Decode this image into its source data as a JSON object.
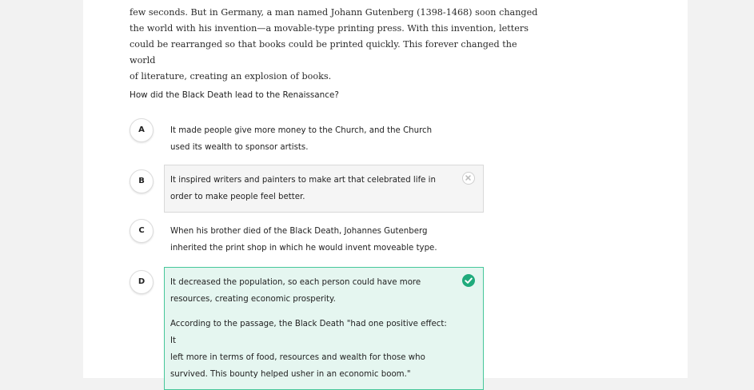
{
  "passage": {
    "lines": [
      "few seconds. But in Germany, a man named Johann Gutenberg (1398-1468) soon changed",
      "the world with his invention—a movable-type printing press. With this invention, letters",
      "could be rearranged so that books could be printed quickly. This forever changed the world",
      "of literature, creating an explosion of books."
    ]
  },
  "question": "How did the Black Death lead to the Renaissance?",
  "options": [
    {
      "letter": "A",
      "lines": [
        "It made people give more money to the Church, and the Church",
        "used its wealth to sponsor artists."
      ],
      "state": "unselected"
    },
    {
      "letter": "B",
      "lines": [
        "It inspired writers and painters to make art that celebrated life in",
        "order to make people feel better."
      ],
      "state": "incorrect",
      "icon": "x-circle-icon"
    },
    {
      "letter": "C",
      "lines": [
        "When his brother died of the Black Death, Johannes Gutenberg",
        "inherited the print shop in which he would invent moveable type."
      ],
      "state": "unselected"
    },
    {
      "letter": "D",
      "lines": [
        "It decreased the population, so each person could have more",
        "resources, creating economic prosperity."
      ],
      "state": "correct",
      "icon": "check-circle-icon",
      "explanation_lines": [
        "According to the passage, the Black Death \"had one positive effect: It",
        "left more in terms of food, resources and wealth for those who",
        "survived. This bounty helped usher in an economic boom.\""
      ]
    }
  ],
  "colors": {
    "correct_border": "#46c79a",
    "correct_bg": "#e5f6f0",
    "correct_icon": "#1fab7c",
    "incorrect_bg": "#f5f5f5",
    "incorrect_border": "#d9d9d9"
  }
}
